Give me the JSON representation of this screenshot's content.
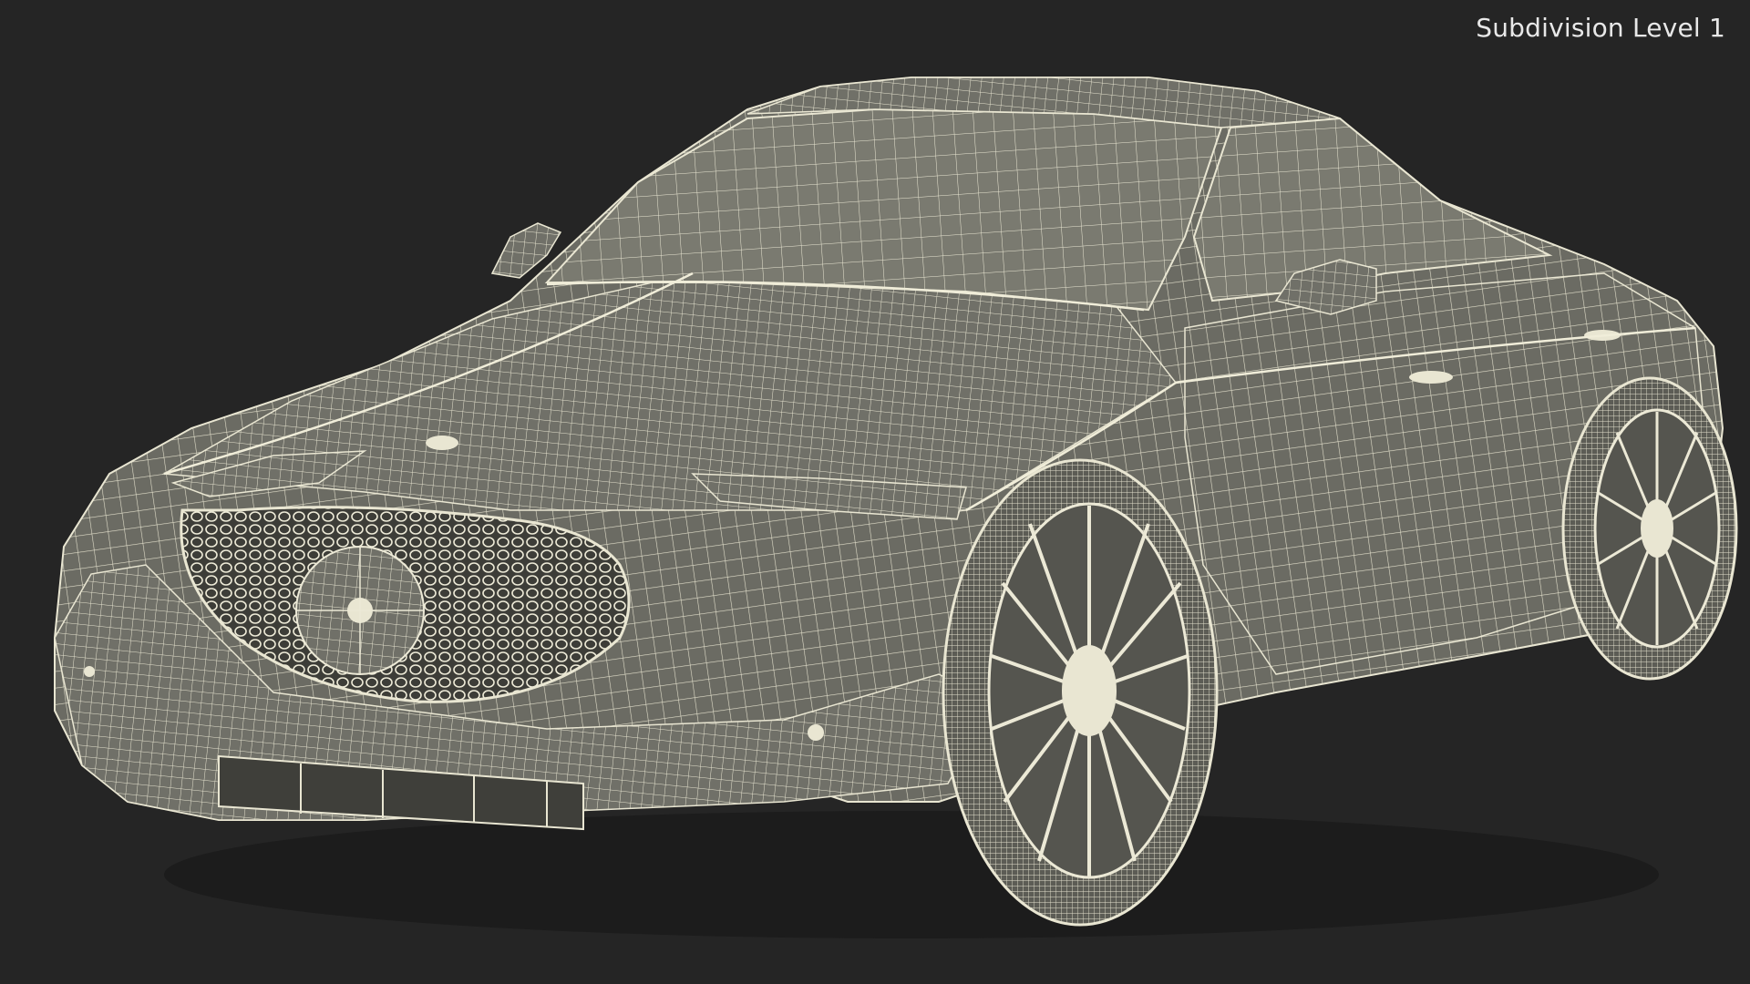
{
  "overlay": {
    "label": "Subdivision Level 1"
  },
  "colors": {
    "background": "#252525",
    "body_fill": "#6e6e66",
    "wire": "#e9e6d2",
    "wire_dim": "#cfcbb6",
    "label_text": "#e8e8e8"
  },
  "subject": {
    "icon": "car-wireframe-icon"
  }
}
